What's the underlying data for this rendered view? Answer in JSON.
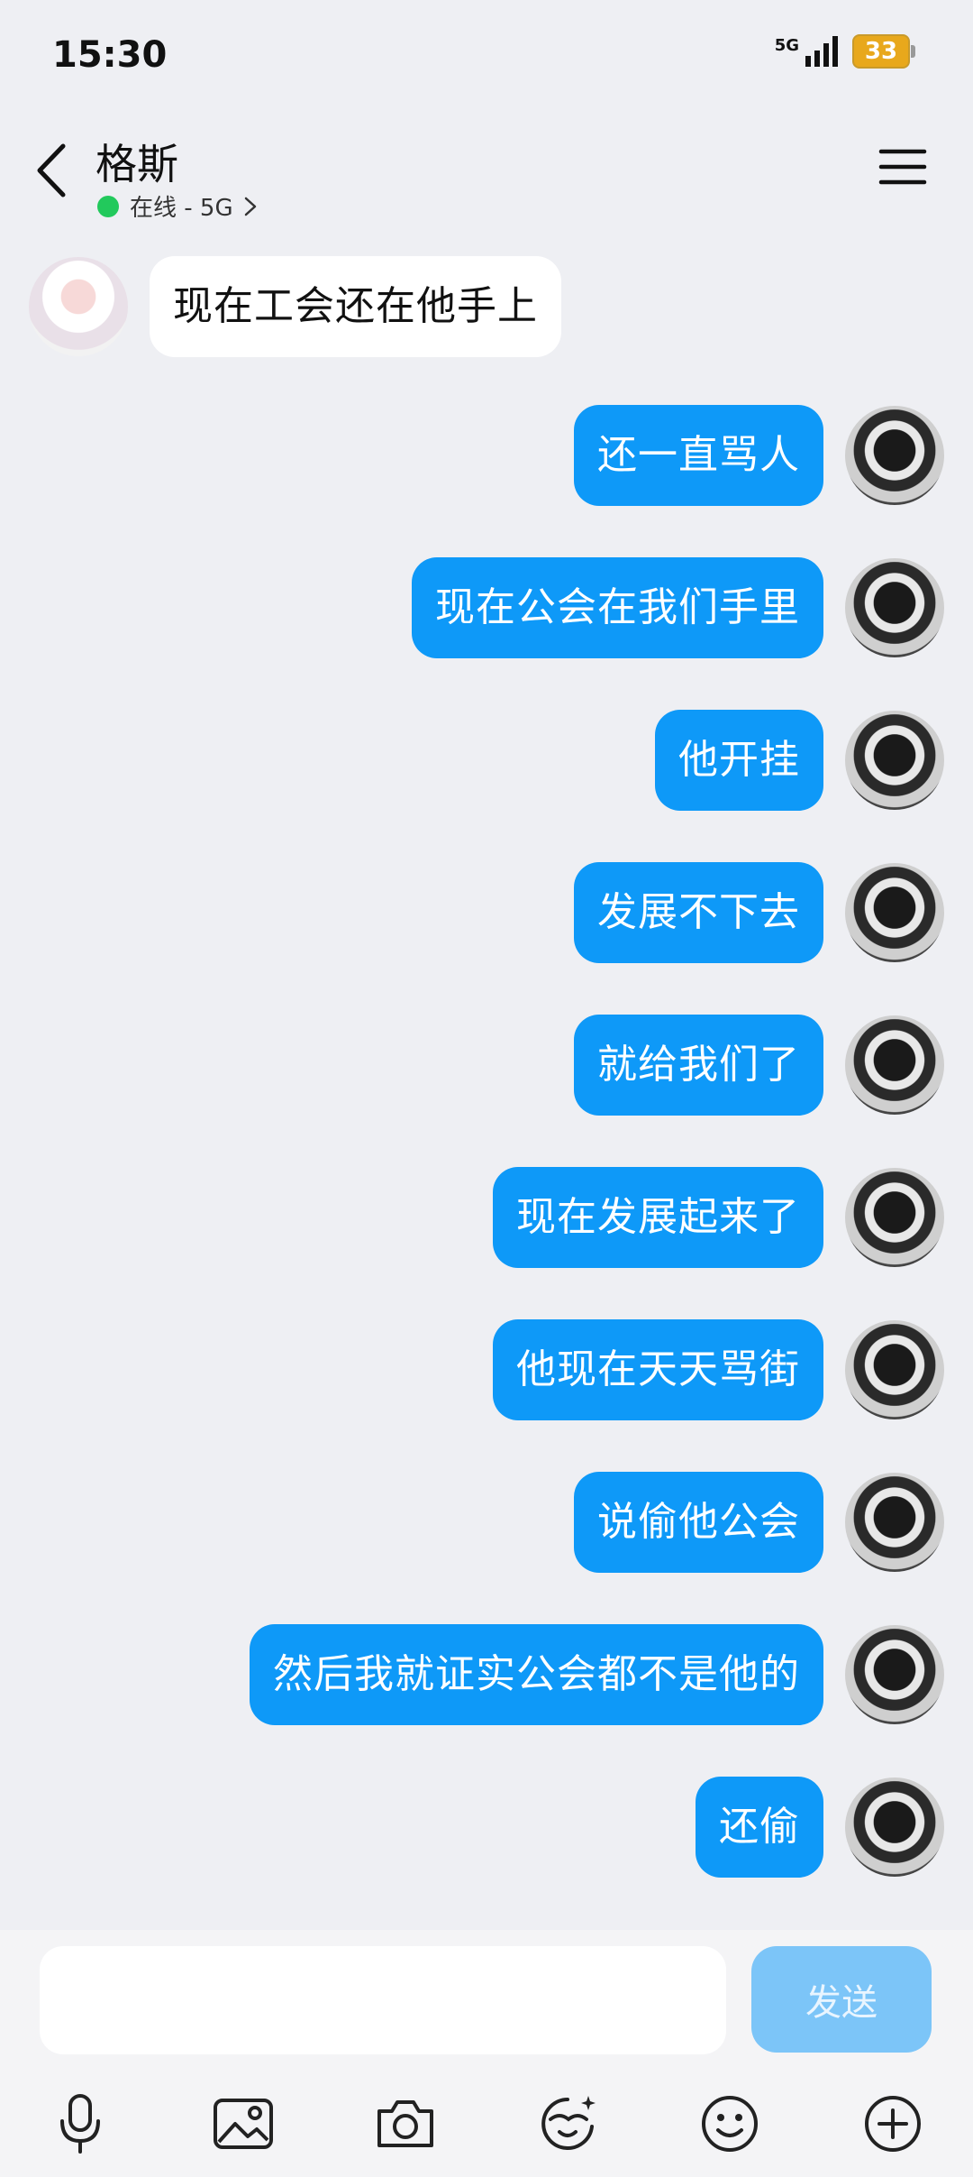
{
  "status_bar": {
    "time": "15:30",
    "network": "5G",
    "battery": "33"
  },
  "header": {
    "contact_name": "格斯",
    "status_text": "在线 - 5G",
    "back_icon": "chevron-left-icon",
    "menu_icon": "hamburger-menu-icon"
  },
  "messages": [
    {
      "direction": "in",
      "text": "现在工会还在他手上"
    },
    {
      "direction": "out",
      "text": "还一直骂人"
    },
    {
      "direction": "out",
      "text": "现在公会在我们手里"
    },
    {
      "direction": "out",
      "text": "他开挂"
    },
    {
      "direction": "out",
      "text": "发展不下去"
    },
    {
      "direction": "out",
      "text": "就给我们了"
    },
    {
      "direction": "out",
      "text": "现在发展起来了"
    },
    {
      "direction": "out",
      "text": "他现在天天骂街"
    },
    {
      "direction": "out",
      "text": "说偷他公会"
    },
    {
      "direction": "out",
      "text": "然后我就证实公会都不是他的"
    },
    {
      "direction": "out",
      "text": "还偷"
    }
  ],
  "composer": {
    "input_value": "",
    "send_label": "发送"
  },
  "toolbar": {
    "icons": [
      "microphone-icon",
      "image-icon",
      "camera-icon",
      "sticker-icon",
      "emoji-icon",
      "plus-icon"
    ]
  },
  "colors": {
    "outgoing_bubble": "#0e99f8",
    "incoming_bubble": "#ffffff",
    "online_dot": "#22c95c",
    "send_button": "#7cc5f8"
  }
}
